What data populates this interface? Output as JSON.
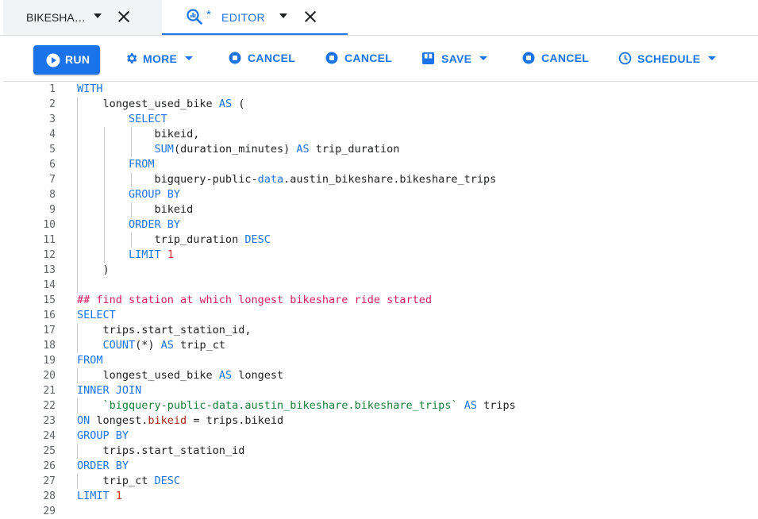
{
  "tabs": [
    {
      "label": "BIKESHA…",
      "active": false
    },
    {
      "label": "EDITOR",
      "active": true,
      "modified_marker": "*"
    }
  ],
  "toolbar": {
    "run_label": "RUN",
    "more_label": "MORE",
    "cancel1_label": "CANCEL",
    "cancel2_label": "CANCEL",
    "save_label": "SAVE",
    "cancel3_label": "CANCEL",
    "schedule_label": "SCHEDULE"
  },
  "colors": {
    "accent": "#1a73e8",
    "keyword": "#1a73e8",
    "comment": "#d81b60",
    "number": "#d93025",
    "string": "#188038"
  },
  "editor": {
    "line_numbers": [
      "1",
      "2",
      "3",
      "4",
      "5",
      "6",
      "7",
      "8",
      "9",
      "10",
      "11",
      "12",
      "13",
      "14",
      "15",
      "16",
      "17",
      "18",
      "19",
      "20",
      "21",
      "22",
      "23",
      "24",
      "25",
      "26",
      "27",
      "28",
      "29"
    ],
    "lines": [
      "WITH",
      "    longest_used_bike AS (",
      "        SELECT",
      "            bikeid,",
      "            SUM(duration_minutes) AS trip_duration",
      "        FROM",
      "            bigquery-public-data.austin_bikeshare.bikeshare_trips",
      "        GROUP BY",
      "            bikeid",
      "        ORDER BY",
      "            trip_duration DESC",
      "        LIMIT 1",
      "    )",
      "",
      "## find station at which longest bikeshare ride started",
      "SELECT",
      "    trips.start_station_id,",
      "    COUNT(*) AS trip_ct",
      "FROM",
      "    longest_used_bike AS longest",
      "INNER JOIN",
      "    `bigquery-public-data.austin_bikeshare.bikeshare_trips` AS trips",
      "ON longest.bikeid = trips.bikeid",
      "GROUP BY",
      "    trips.start_station_id",
      "ORDER BY",
      "    trip_ct DESC",
      "LIMIT 1",
      ""
    ]
  }
}
